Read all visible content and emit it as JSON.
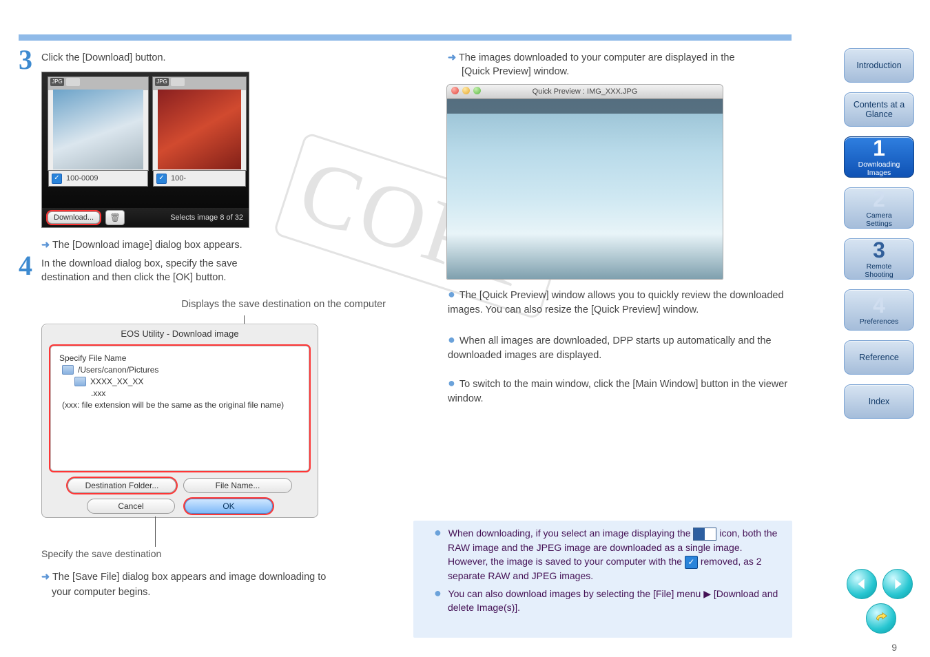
{
  "top_bar": true,
  "steps": {
    "three": {
      "num": "3",
      "text": "Click the [Download] button."
    },
    "four": {
      "num": "4",
      "line1": "In the download dialog box, specify the save",
      "line2": "destination and then click the [OK] button."
    }
  },
  "dialog_appears": "The [Download image] dialog box appears.",
  "dest_callout": "Displays the save destination on the computer",
  "thumb": {
    "name1": "100-0009",
    "name2": "100-",
    "sel_label": "Selects image 8 of 32",
    "download_btn": "Download..."
  },
  "dialog": {
    "title": "EOS Utility - Download image",
    "heading": "Specify File Name",
    "path": "/Users/canon/Pictures",
    "subfolder": "XXXX_XX_XX",
    "ext": ".xxx",
    "note": "(xxx: file extension will be the same as the original file name)",
    "btn_destination": "Destination Folder...",
    "btn_filename": "File Name...",
    "btn_cancel": "Cancel",
    "btn_ok": "OK"
  },
  "dest_folder_callout": "Specify the save destination",
  "save_line": "The [Save File] dialog box appears and image downloading to",
  "save_line2": "your computer begins.",
  "linked_line": "The images downloaded to your computer are displayed in the [Quick Preview] window.",
  "preview": {
    "title": "Quick Preview : IMG_XXX.JPG"
  },
  "right": {
    "line1": "The images downloaded to your computer are displayed in the",
    "line2": "[Quick Preview] window.",
    "tip1": "The [Quick Preview] window allows you to quickly review the downloaded images. You can also resize the [Quick Preview] window.",
    "tip2": "When all images are downloaded, DPP starts up automatically and the downloaded images are displayed.",
    "tip3": "To switch to the main window, click the [Main Window] button in the viewer window."
  },
  "notes": {
    "n1_a": "When downloading, if you select an image displaying the ",
    "n1_b": "icon, both the RAW image and the JPEG image are downloaded",
    "n1_c": "as a single image. However, the image is saved to your",
    "n1_d": "computer with the ",
    "n1_e": " removed, as 2 separate RAW and JPEG",
    "n1_f": "images.",
    "n2": "You can also download images by selecting the [File] menu ▶ [Download and delete Image(s)]."
  },
  "sidebar": {
    "intro": "Introduction",
    "contents": "Contents at a Glance",
    "downloading_a": "Downloading",
    "downloading_b": "Images",
    "camset_a": "Camera",
    "camset_b": "Settings",
    "remote_a": "Remote",
    "remote_b": "Shooting",
    "pref": "Preferences",
    "ref": "Reference",
    "index": "Index"
  },
  "page_number": "9",
  "watermark": "COPY"
}
